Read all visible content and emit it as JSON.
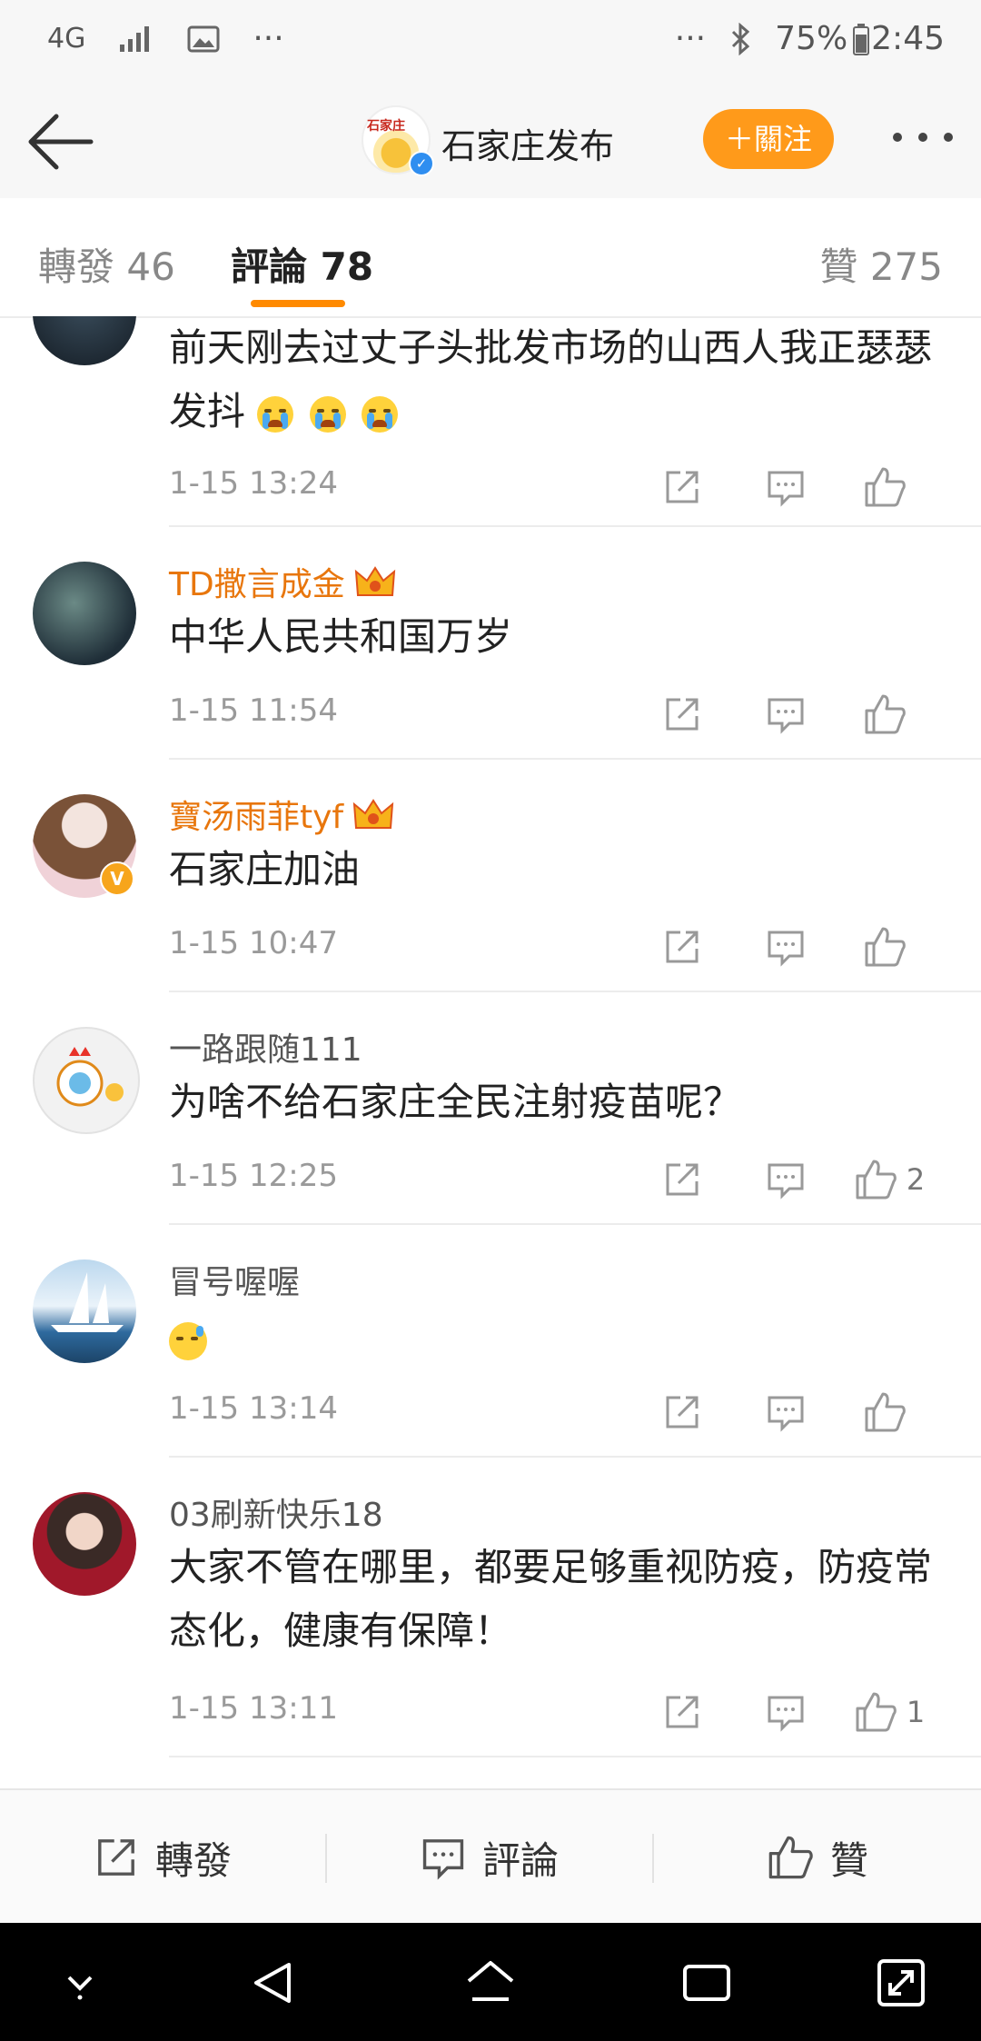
{
  "status_bar": {
    "network": "4G",
    "dots_left": "···",
    "dots_right": "···",
    "battery": "75%",
    "time": "2:45"
  },
  "header": {
    "logo_text": "石家庄",
    "title": "石家庄发布",
    "follow_label": "＋關注"
  },
  "tabs": {
    "repost": "轉發 46",
    "comments": "評論 78",
    "likes": "贊 275"
  },
  "comments": [
    {
      "name": "",
      "text": "前天刚去过丈子头批发市场的山西人我正瑟瑟发抖",
      "emojis": 3,
      "time": "1-15 13:24",
      "likes": ""
    },
    {
      "name": "TD撒言成金",
      "text": "中华人民共和国万岁",
      "time": "1-15 11:54",
      "likes": ""
    },
    {
      "name": "寶汤雨菲tyf",
      "text": "石家庄加油",
      "time": "1-15 10:47",
      "likes": ""
    },
    {
      "name": "一路跟随111",
      "text": "为啥不给石家庄全民注射疫苗呢？",
      "time": "1-15 12:25",
      "likes": "2"
    },
    {
      "name": "冒号喔喔",
      "text": "",
      "time": "1-15 13:14",
      "likes": ""
    },
    {
      "name": "03刷新快乐18",
      "text": "大家不管在哪里，都要足够重视防疫，防疫常态化，健康有保障！",
      "time": "1-15 13:11",
      "likes": "1"
    }
  ],
  "bottom_bar": {
    "repost": "轉發",
    "comment": "評論",
    "like": "贊"
  },
  "colors": {
    "accent": "#ff9a1a",
    "vip_name": "#e8760c",
    "tab_underline": "#ff8a00"
  }
}
